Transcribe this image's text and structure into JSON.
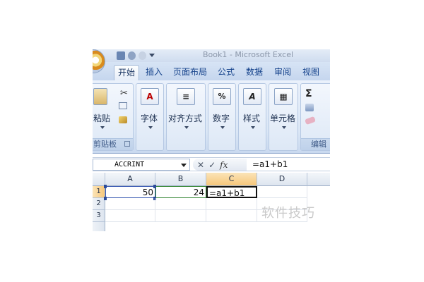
{
  "window": {
    "title": "Book1 - Microsoft Excel"
  },
  "ribbon": {
    "tabs": [
      {
        "label": "开始",
        "active": true
      },
      {
        "label": "插入"
      },
      {
        "label": "页面布局"
      },
      {
        "label": "公式"
      },
      {
        "label": "数据"
      },
      {
        "label": "审阅"
      },
      {
        "label": "视图"
      }
    ],
    "groups": {
      "clipboard": {
        "paste_label": "粘贴",
        "group_label": "剪贴板"
      },
      "font": {
        "label": "字体",
        "icon_text": "A"
      },
      "alignment": {
        "label": "对齐方式",
        "icon_text": "≡"
      },
      "number": {
        "label": "数字",
        "icon_text": "%"
      },
      "styles": {
        "label": "样式",
        "icon_text": "A"
      },
      "cells": {
        "label": "单元格",
        "icon_text": "▦"
      },
      "editing": {
        "sum_icon_text": "Σ",
        "group_label": "编辑"
      }
    }
  },
  "formula_bar": {
    "name_box": "ACCRINT",
    "cancel_icon_text": "✕",
    "enter_icon_text": "✓",
    "fx_label": "fx",
    "formula": "=a1+b1"
  },
  "sheet": {
    "columns": [
      "A",
      "B",
      "C",
      "D"
    ],
    "rows": [
      "1",
      "2",
      "3"
    ],
    "cells": {
      "A1": "50",
      "B1": "24",
      "C1": "=a1+b1"
    }
  },
  "watermark": "软件技巧",
  "colors": {
    "ribbon_tab_text": "#15428b",
    "selected_header": "#f6c77a",
    "a1_ref": "#3b5bb3",
    "b1_ref": "#3a8a3a"
  }
}
